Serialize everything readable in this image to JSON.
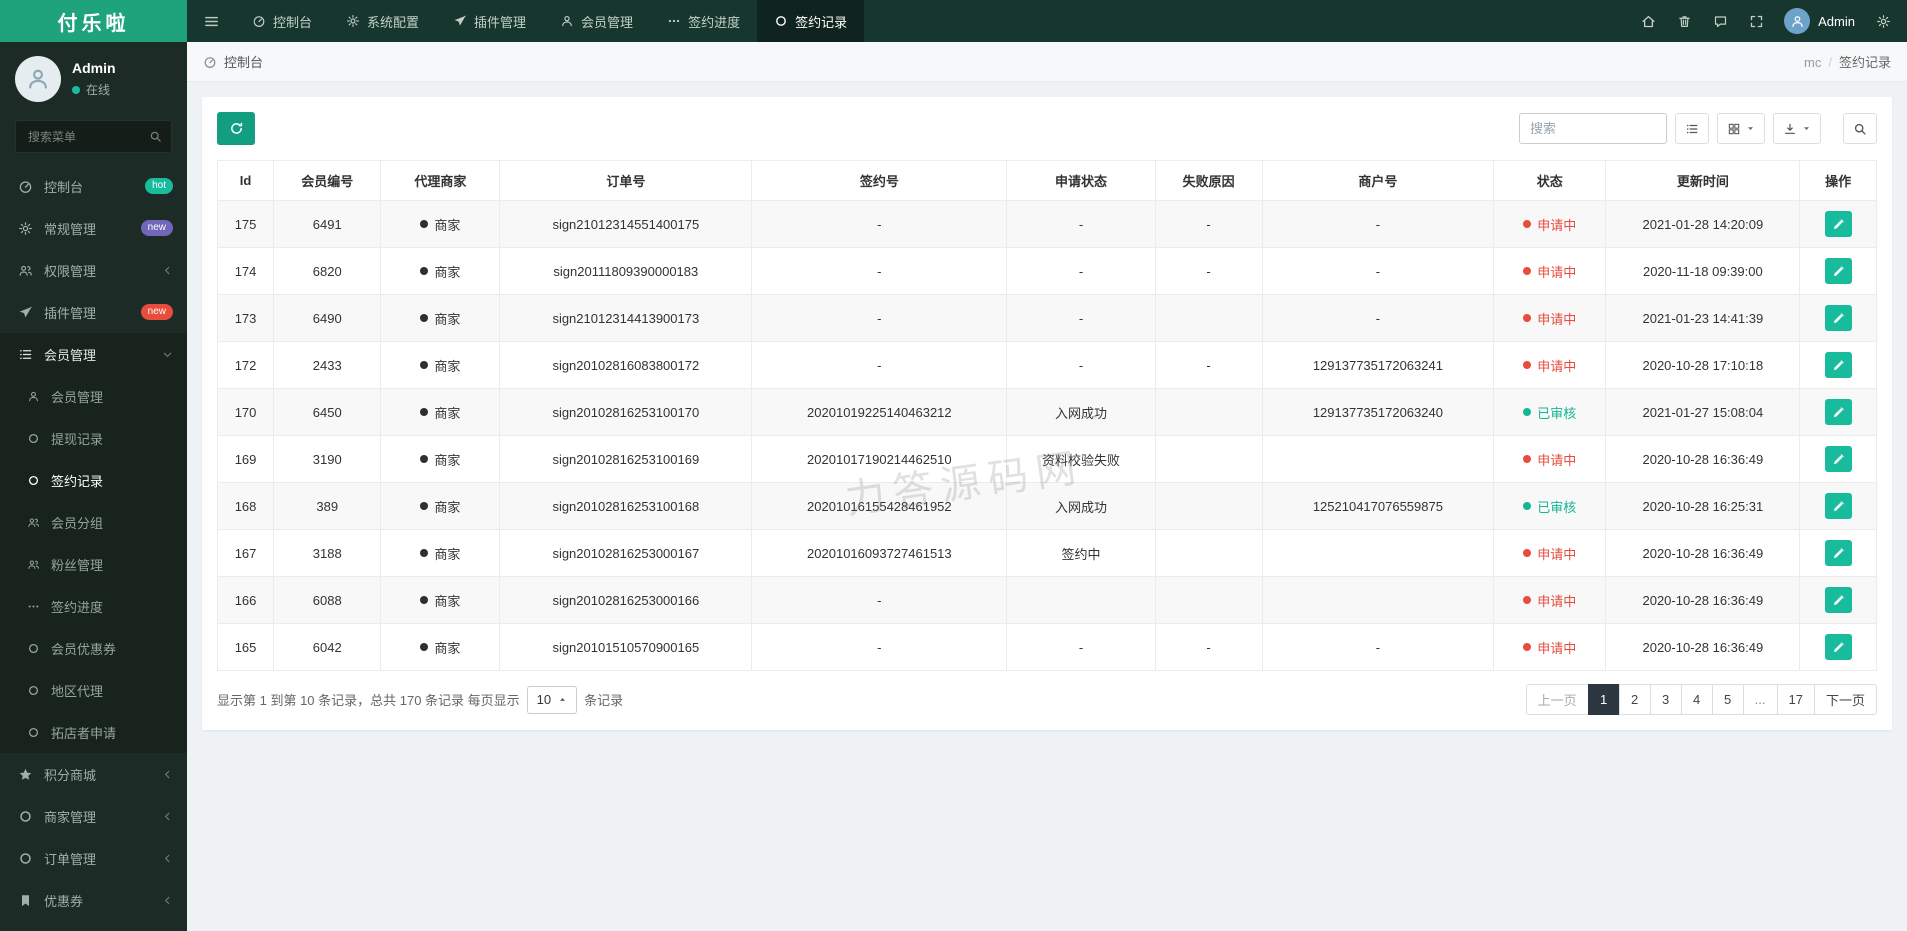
{
  "brand": {
    "logo_text": "付乐啦"
  },
  "topbar": {
    "nav": [
      {
        "key": "dashboard",
        "label": "控制台",
        "icon": "dashboard-icon",
        "active": false
      },
      {
        "key": "config",
        "label": "系统配置",
        "icon": "gear-icon",
        "active": false
      },
      {
        "key": "addon",
        "label": "插件管理",
        "icon": "plugin-icon",
        "active": false
      },
      {
        "key": "user",
        "label": "会员管理",
        "icon": "members-icon",
        "active": false
      },
      {
        "key": "sign-progress",
        "label": "签约进度",
        "icon": "progress-icon",
        "active": false
      },
      {
        "key": "sign-log",
        "label": "签约记录",
        "icon": "record-icon",
        "active": true
      }
    ],
    "actions": [
      "home-icon",
      "trash-icon",
      "message-icon",
      "fullscreen-icon"
    ],
    "username": "Admin"
  },
  "sidebar": {
    "username": "Admin",
    "online_status": "在线",
    "search_placeholder": "搜索菜单",
    "menu": [
      {
        "key": "dashboard",
        "label": "控制台",
        "icon": "dashboard-icon",
        "badge": {
          "text": "hot",
          "color": "#18bc9c"
        }
      },
      {
        "key": "general",
        "label": "常规管理",
        "icon": "gears-icon",
        "badge": {
          "text": "new",
          "color": "#7266ba"
        }
      },
      {
        "key": "auth",
        "label": "权限管理",
        "icon": "users-icon",
        "arrow": "left"
      },
      {
        "key": "addon",
        "label": "插件管理",
        "icon": "plugin-icon",
        "badge": {
          "text": "new",
          "color": "#e74c3c"
        }
      },
      {
        "key": "user",
        "label": "会员管理",
        "icon": "list-icon",
        "arrow": "down",
        "active": true,
        "children": [
          {
            "key": "user",
            "label": "会员管理",
            "icon": "user-icon"
          },
          {
            "key": "withdraw-log",
            "label": "提现记录",
            "icon": "circle-icon"
          },
          {
            "key": "sign-log",
            "label": "签约记录",
            "icon": "circle-icon",
            "active": true
          },
          {
            "key": "user-group",
            "label": "会员分组",
            "icon": "users-icon"
          },
          {
            "key": "fans",
            "label": "粉丝管理",
            "icon": "users-icon"
          },
          {
            "key": "sign-progress",
            "label": "签约进度",
            "icon": "ellipsis-icon"
          },
          {
            "key": "user-coupon",
            "label": "会员优惠券",
            "icon": "circle-icon"
          },
          {
            "key": "area-agent",
            "label": "地区代理",
            "icon": "circle-icon"
          },
          {
            "key": "shop-apply",
            "label": "拓店者申请",
            "icon": "circle-icon"
          }
        ]
      },
      {
        "key": "score-mall",
        "label": "积分商城",
        "icon": "star-icon",
        "arrow": "left"
      },
      {
        "key": "merchant",
        "label": "商家管理",
        "icon": "circle-icon",
        "arrow": "left"
      },
      {
        "key": "order",
        "label": "订单管理",
        "icon": "circle-icon",
        "arrow": "left"
      },
      {
        "key": "coupon",
        "label": "优惠券",
        "icon": "flag-icon",
        "arrow": "left"
      }
    ]
  },
  "breadcrumb": {
    "home_label": "控制台",
    "section": "mc",
    "page": "签约记录"
  },
  "toolbar": {
    "search_placeholder": "搜索"
  },
  "table": {
    "columns": [
      "Id",
      "会员编号",
      "代理商家",
      "订单号",
      "签约号",
      "申请状态",
      "失败原因",
      "商户号",
      "状态",
      "更新时间",
      "操作"
    ],
    "agent_label": "商家",
    "rows": [
      {
        "id": "175",
        "member_no": "6491",
        "order_no": "sign21012314551400175",
        "sign_no": "-",
        "apply_status": "-",
        "fail_reason": "-",
        "merchant_no": "-",
        "status": "申请中",
        "status_type": "pending",
        "updated": "2021-01-28 14:20:09"
      },
      {
        "id": "174",
        "member_no": "6820",
        "order_no": "sign20111809390000183",
        "sign_no": "-",
        "apply_status": "-",
        "fail_reason": "-",
        "merchant_no": "-",
        "status": "申请中",
        "status_type": "pending",
        "updated": "2020-11-18 09:39:00"
      },
      {
        "id": "173",
        "member_no": "6490",
        "order_no": "sign21012314413900173",
        "sign_no": "-",
        "apply_status": "-",
        "fail_reason": "",
        "merchant_no": "-",
        "status": "申请中",
        "status_type": "pending",
        "updated": "2021-01-23 14:41:39"
      },
      {
        "id": "172",
        "member_no": "2433",
        "order_no": "sign20102816083800172",
        "sign_no": "-",
        "apply_status": "-",
        "fail_reason": "-",
        "merchant_no": "129137735172063241",
        "status": "申请中",
        "status_type": "pending",
        "updated": "2020-10-28 17:10:18"
      },
      {
        "id": "170",
        "member_no": "6450",
        "order_no": "sign20102816253100170",
        "sign_no": "20201019225140463212",
        "apply_status": "入网成功",
        "fail_reason": "",
        "merchant_no": "129137735172063240",
        "status": "已审核",
        "status_type": "approved",
        "updated": "2021-01-27 15:08:04"
      },
      {
        "id": "169",
        "member_no": "3190",
        "order_no": "sign20102816253100169",
        "sign_no": "20201017190214462510",
        "apply_status": "资料校验失败",
        "fail_reason": "",
        "merchant_no": "",
        "status": "申请中",
        "status_type": "pending",
        "updated": "2020-10-28 16:36:49"
      },
      {
        "id": "168",
        "member_no": "389",
        "order_no": "sign20102816253100168",
        "sign_no": "20201016155428461952",
        "apply_status": "入网成功",
        "fail_reason": "",
        "merchant_no": "125210417076559875",
        "status": "已审核",
        "status_type": "approved",
        "updated": "2020-10-28 16:25:31"
      },
      {
        "id": "167",
        "member_no": "3188",
        "order_no": "sign20102816253000167",
        "sign_no": "20201016093727461513",
        "apply_status": "签约中",
        "fail_reason": "",
        "merchant_no": "",
        "status": "申请中",
        "status_type": "pending",
        "updated": "2020-10-28 16:36:49"
      },
      {
        "id": "166",
        "member_no": "6088",
        "order_no": "sign20102816253000166",
        "sign_no": "-",
        "apply_status": "",
        "fail_reason": "",
        "merchant_no": "",
        "status": "申请中",
        "status_type": "pending",
        "updated": "2020-10-28 16:36:49"
      },
      {
        "id": "165",
        "member_no": "6042",
        "order_no": "sign20101510570900165",
        "sign_no": "-",
        "apply_status": "-",
        "fail_reason": "-",
        "merchant_no": "-",
        "status": "申请中",
        "status_type": "pending",
        "updated": "2020-10-28 16:36:49"
      }
    ]
  },
  "pagination": {
    "summary": "显示第 1 到第 10 条记录，总共 170 条记录 每页显示",
    "page_size": "10",
    "summary_suffix": "条记录",
    "pages": [
      {
        "label": "上一页",
        "type": "prev"
      },
      {
        "label": "1",
        "type": "page",
        "active": true
      },
      {
        "label": "2",
        "type": "page"
      },
      {
        "label": "3",
        "type": "page"
      },
      {
        "label": "4",
        "type": "page"
      },
      {
        "label": "5",
        "type": "page"
      },
      {
        "label": "...",
        "type": "ellipsis"
      },
      {
        "label": "17",
        "type": "page"
      },
      {
        "label": "下一页",
        "type": "next"
      }
    ]
  },
  "watermark": "力答源码网",
  "colors": {
    "accent": "#18bc9c",
    "logo_green": "#1fa37c",
    "topbar": "#17362d",
    "sidebar": "#1d2b26",
    "status_pending": "#e74c3c",
    "status_approved": "#13b795",
    "pagination_active": "#2d3742",
    "badge_hot": "#18bc9c",
    "badge_new_purple": "#7266ba",
    "badge_new_red": "#e74c3c"
  }
}
